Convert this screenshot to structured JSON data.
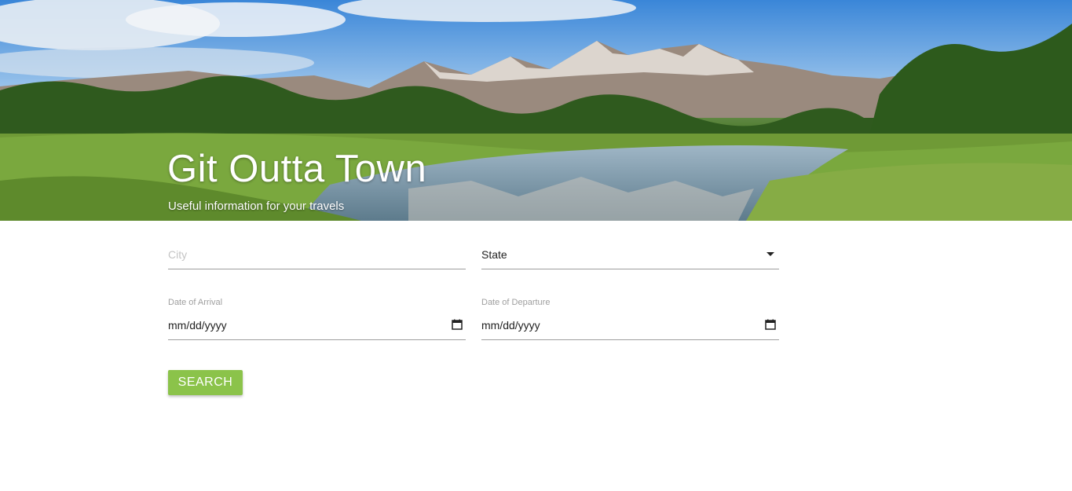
{
  "hero": {
    "title": "Git Outta Town",
    "subtitle": "Useful information for your travels"
  },
  "form": {
    "city": {
      "placeholder": "City",
      "value": ""
    },
    "state": {
      "selected": "State"
    },
    "arrival": {
      "label": "Date of Arrival",
      "value": "mm/dd/yyyy",
      "icon": "calendar-icon"
    },
    "departure": {
      "label": "Date of Departure",
      "value": "mm/dd/yyyy",
      "icon": "calendar-icon"
    },
    "search_label": "SEARCH"
  },
  "colors": {
    "accent": "#8bc34a",
    "underline": "#9e9e9e",
    "label": "#9e9e9e"
  }
}
